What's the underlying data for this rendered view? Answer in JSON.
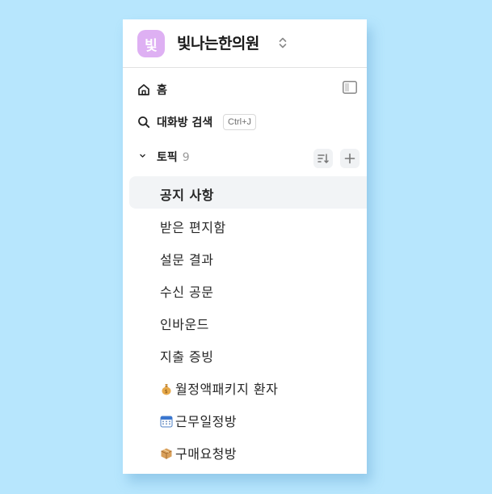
{
  "workspace": {
    "avatar_char": "빛",
    "name": "빛나는한의원",
    "avatar_color": "#deb0f3"
  },
  "nav": {
    "home_label": "홈",
    "search_label": "대화방 검색",
    "search_shortcut": "Ctrl+J"
  },
  "topics": {
    "label": "토픽",
    "count": "9",
    "items": [
      {
        "label": "공지 사항",
        "active": true
      },
      {
        "label": "받은 편지함"
      },
      {
        "label": "설문 결과"
      },
      {
        "label": "수신 공문"
      },
      {
        "label": "인바운드"
      },
      {
        "label": "지출 증빙"
      },
      {
        "label": "월정액패키지 환자",
        "icon": "money-bag-icon"
      },
      {
        "label": "근무일정방",
        "icon": "calendar-icon"
      },
      {
        "label": "구매요청방",
        "icon": "package-icon"
      }
    ]
  },
  "colors": {
    "background": "#b7e6fd",
    "active_row": "#f2f4f6"
  }
}
